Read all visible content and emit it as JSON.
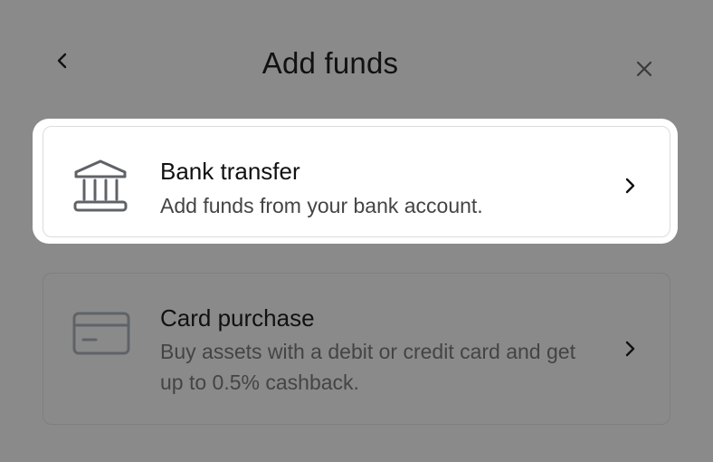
{
  "modal": {
    "title": "Add funds",
    "back_icon": "chevron-left-icon",
    "close_icon": "close-icon"
  },
  "options": [
    {
      "title": "Bank transfer",
      "description": "Add funds from your bank account.",
      "icon": "bank-icon",
      "highlighted": true
    },
    {
      "title": "Card purchase",
      "description": "Buy assets with a debit or credit card and get up to 0.5% cashback.",
      "icon": "credit-card-icon",
      "highlighted": false
    }
  ],
  "colors": {
    "overlay": "#8a8a8a",
    "card_bg": "#ffffff",
    "text_primary": "#111111",
    "text_secondary": "#444444",
    "icon_gray": "#5f6368"
  }
}
